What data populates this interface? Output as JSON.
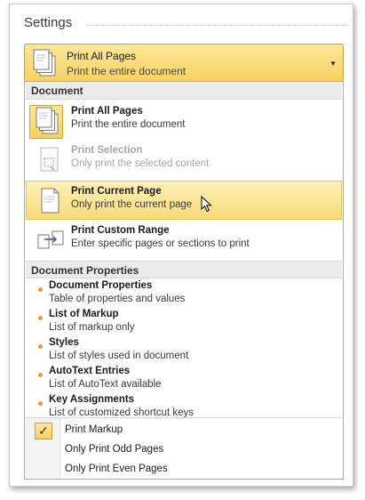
{
  "title": "Settings",
  "dropdown": {
    "title": "Print All Pages",
    "subtitle": "Print the entire document",
    "icon": "pages-stack-icon"
  },
  "sections": {
    "document": "Document",
    "properties": "Document Properties"
  },
  "options": [
    {
      "title": "Print All Pages",
      "desc": "Print the entire document",
      "icon": "pages-stack-icon",
      "selected": true,
      "enabled": true
    },
    {
      "title": "Print Selection",
      "desc": "Only print the selected content",
      "icon": "selection-page-icon",
      "selected": false,
      "enabled": false
    },
    {
      "title": "Print Current Page",
      "desc": "Only print the current page",
      "icon": "single-page-icon",
      "selected": false,
      "enabled": true,
      "hovered": true
    },
    {
      "title": "Print Custom Range",
      "desc": "Enter specific pages or sections to print",
      "icon": "page-range-icon",
      "selected": false,
      "enabled": true
    }
  ],
  "properties": [
    {
      "title": "Document Properties",
      "desc": "Table of properties and values"
    },
    {
      "title": "List of Markup",
      "desc": "List of markup only"
    },
    {
      "title": "Styles",
      "desc": "List of styles used in document"
    },
    {
      "title": "AutoText Entries",
      "desc": "List of AutoText available"
    },
    {
      "title": "Key Assignments",
      "desc": "List of customized shortcut keys"
    }
  ],
  "toggles": [
    {
      "label": "Print Markup",
      "checked": true
    },
    {
      "label": "Only Print Odd Pages",
      "checked": false
    },
    {
      "label": "Only Print Even Pages",
      "checked": false
    }
  ],
  "colors": {
    "accent": "#f7d25f",
    "accent_border": "#c5a23a",
    "bullet": "#e8952c"
  }
}
